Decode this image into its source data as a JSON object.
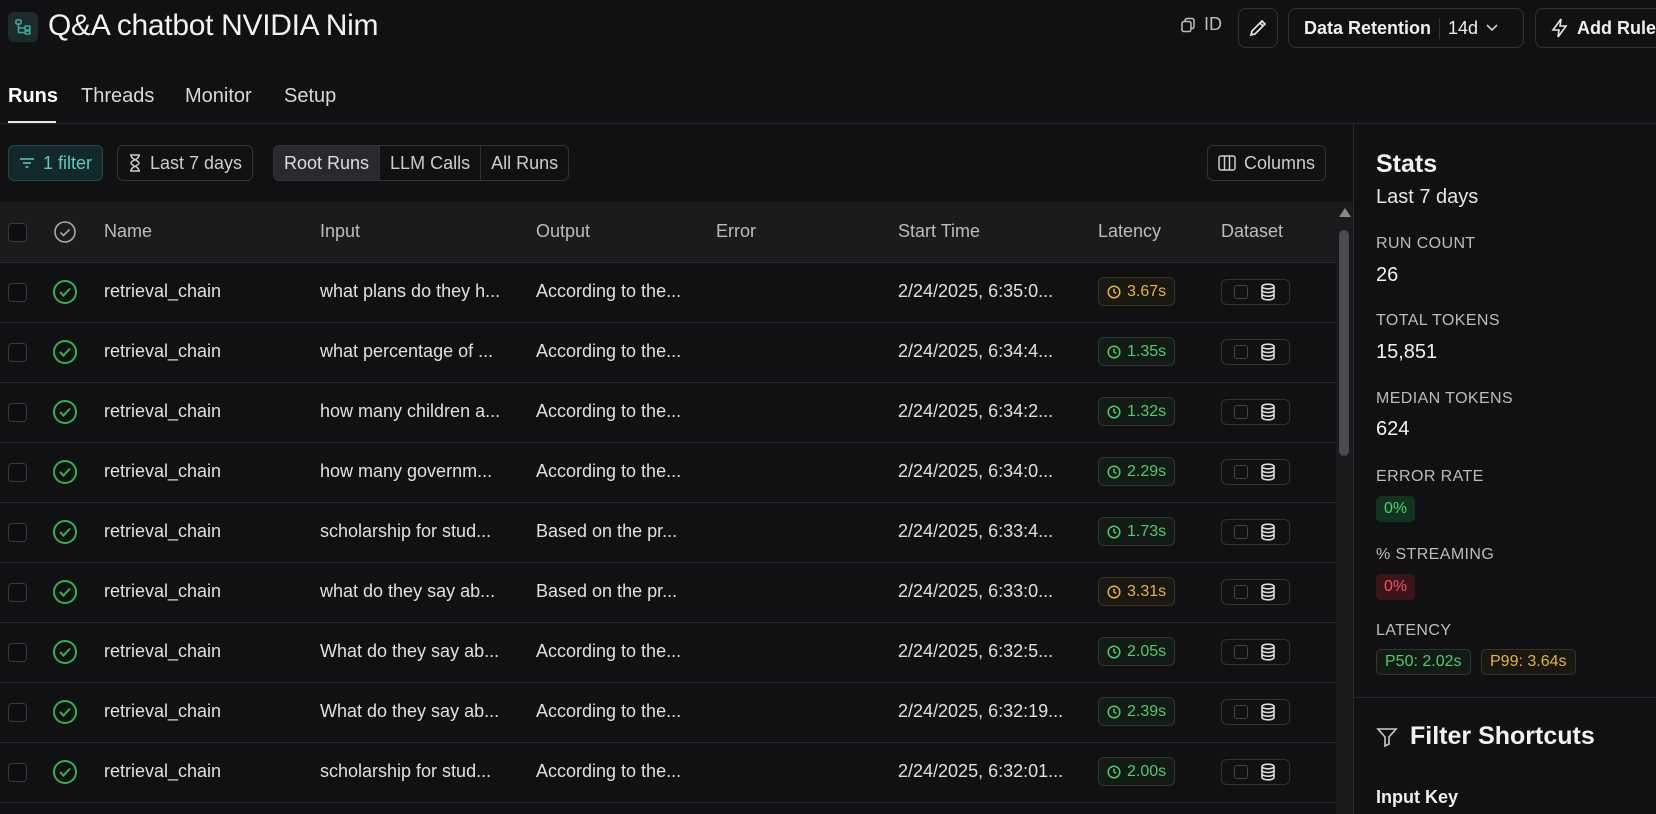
{
  "header": {
    "title": "Q&A chatbot NVIDIA Nim",
    "id_label": "ID",
    "retention_label": "Data Retention",
    "retention_value": "14d",
    "add_rule_label": "Add Rule"
  },
  "tabs": [
    {
      "label": "Runs",
      "active": true
    },
    {
      "label": "Threads"
    },
    {
      "label": "Monitor"
    },
    {
      "label": "Setup"
    }
  ],
  "toolbar": {
    "filter_label": "1 filter",
    "time_label": "Last 7 days",
    "run_types": [
      "Root Runs",
      "LLM Calls",
      "All Runs"
    ],
    "columns_label": "Columns"
  },
  "table": {
    "headers": {
      "name": "Name",
      "input": "Input",
      "output": "Output",
      "error": "Error",
      "start_time": "Start Time",
      "latency": "Latency",
      "dataset": "Dataset"
    },
    "rows": [
      {
        "name": "retrieval_chain",
        "input": "what plans do they h...",
        "output": "According to the...",
        "error": "",
        "start": "2/24/2025, 6:35:0...",
        "latency": "3.67s",
        "lat_status": "warn"
      },
      {
        "name": "retrieval_chain",
        "input": "what percentage of ...",
        "output": "According to the...",
        "error": "",
        "start": "2/24/2025, 6:34:4...",
        "latency": "1.35s",
        "lat_status": "ok"
      },
      {
        "name": "retrieval_chain",
        "input": "how many children a...",
        "output": "According to the...",
        "error": "",
        "start": "2/24/2025, 6:34:2...",
        "latency": "1.32s",
        "lat_status": "ok"
      },
      {
        "name": "retrieval_chain",
        "input": "how many governm...",
        "output": "According to the...",
        "error": "",
        "start": "2/24/2025, 6:34:0...",
        "latency": "2.29s",
        "lat_status": "ok"
      },
      {
        "name": "retrieval_chain",
        "input": "scholarship for stud...",
        "output": "Based on the pr...",
        "error": "",
        "start": "2/24/2025, 6:33:4...",
        "latency": "1.73s",
        "lat_status": "ok"
      },
      {
        "name": "retrieval_chain",
        "input": "what do they say ab...",
        "output": "Based on the pr...",
        "error": "",
        "start": "2/24/2025, 6:33:0...",
        "latency": "3.31s",
        "lat_status": "warn"
      },
      {
        "name": "retrieval_chain",
        "input": "What do they say ab...",
        "output": "According to the...",
        "error": "",
        "start": "2/24/2025, 6:32:5...",
        "latency": "2.05s",
        "lat_status": "ok"
      },
      {
        "name": "retrieval_chain",
        "input": "What do they say ab...",
        "output": "According to the...",
        "error": "",
        "start": "2/24/2025, 6:32:19...",
        "latency": "2.39s",
        "lat_status": "ok"
      },
      {
        "name": "retrieval_chain",
        "input": "scholarship for stud...",
        "output": "According to the...",
        "error": "",
        "start": "2/24/2025, 6:32:01...",
        "latency": "2.00s",
        "lat_status": "ok"
      }
    ]
  },
  "stats": {
    "title": "Stats",
    "period": "Last 7 days",
    "run_count_label": "RUN COUNT",
    "run_count": "26",
    "total_tokens_label": "TOTAL TOKENS",
    "total_tokens": "15,851",
    "median_tokens_label": "MEDIAN TOKENS",
    "median_tokens": "624",
    "error_rate_label": "ERROR RATE",
    "error_rate": "0%",
    "streaming_label": "% STREAMING",
    "streaming": "0%",
    "latency_label": "LATENCY",
    "p50": "P50: 2.02s",
    "p99": "P99: 3.64s"
  },
  "filter_shortcuts": {
    "title": "Filter Shortcuts",
    "input_key_label": "Input Key"
  },
  "colors": {
    "background": "#111113",
    "ok_green": "#4ccd6a",
    "warn_yellow": "#e9b530",
    "error_red": "#ff4d5e",
    "filter_teal": "#5ec9c0"
  }
}
